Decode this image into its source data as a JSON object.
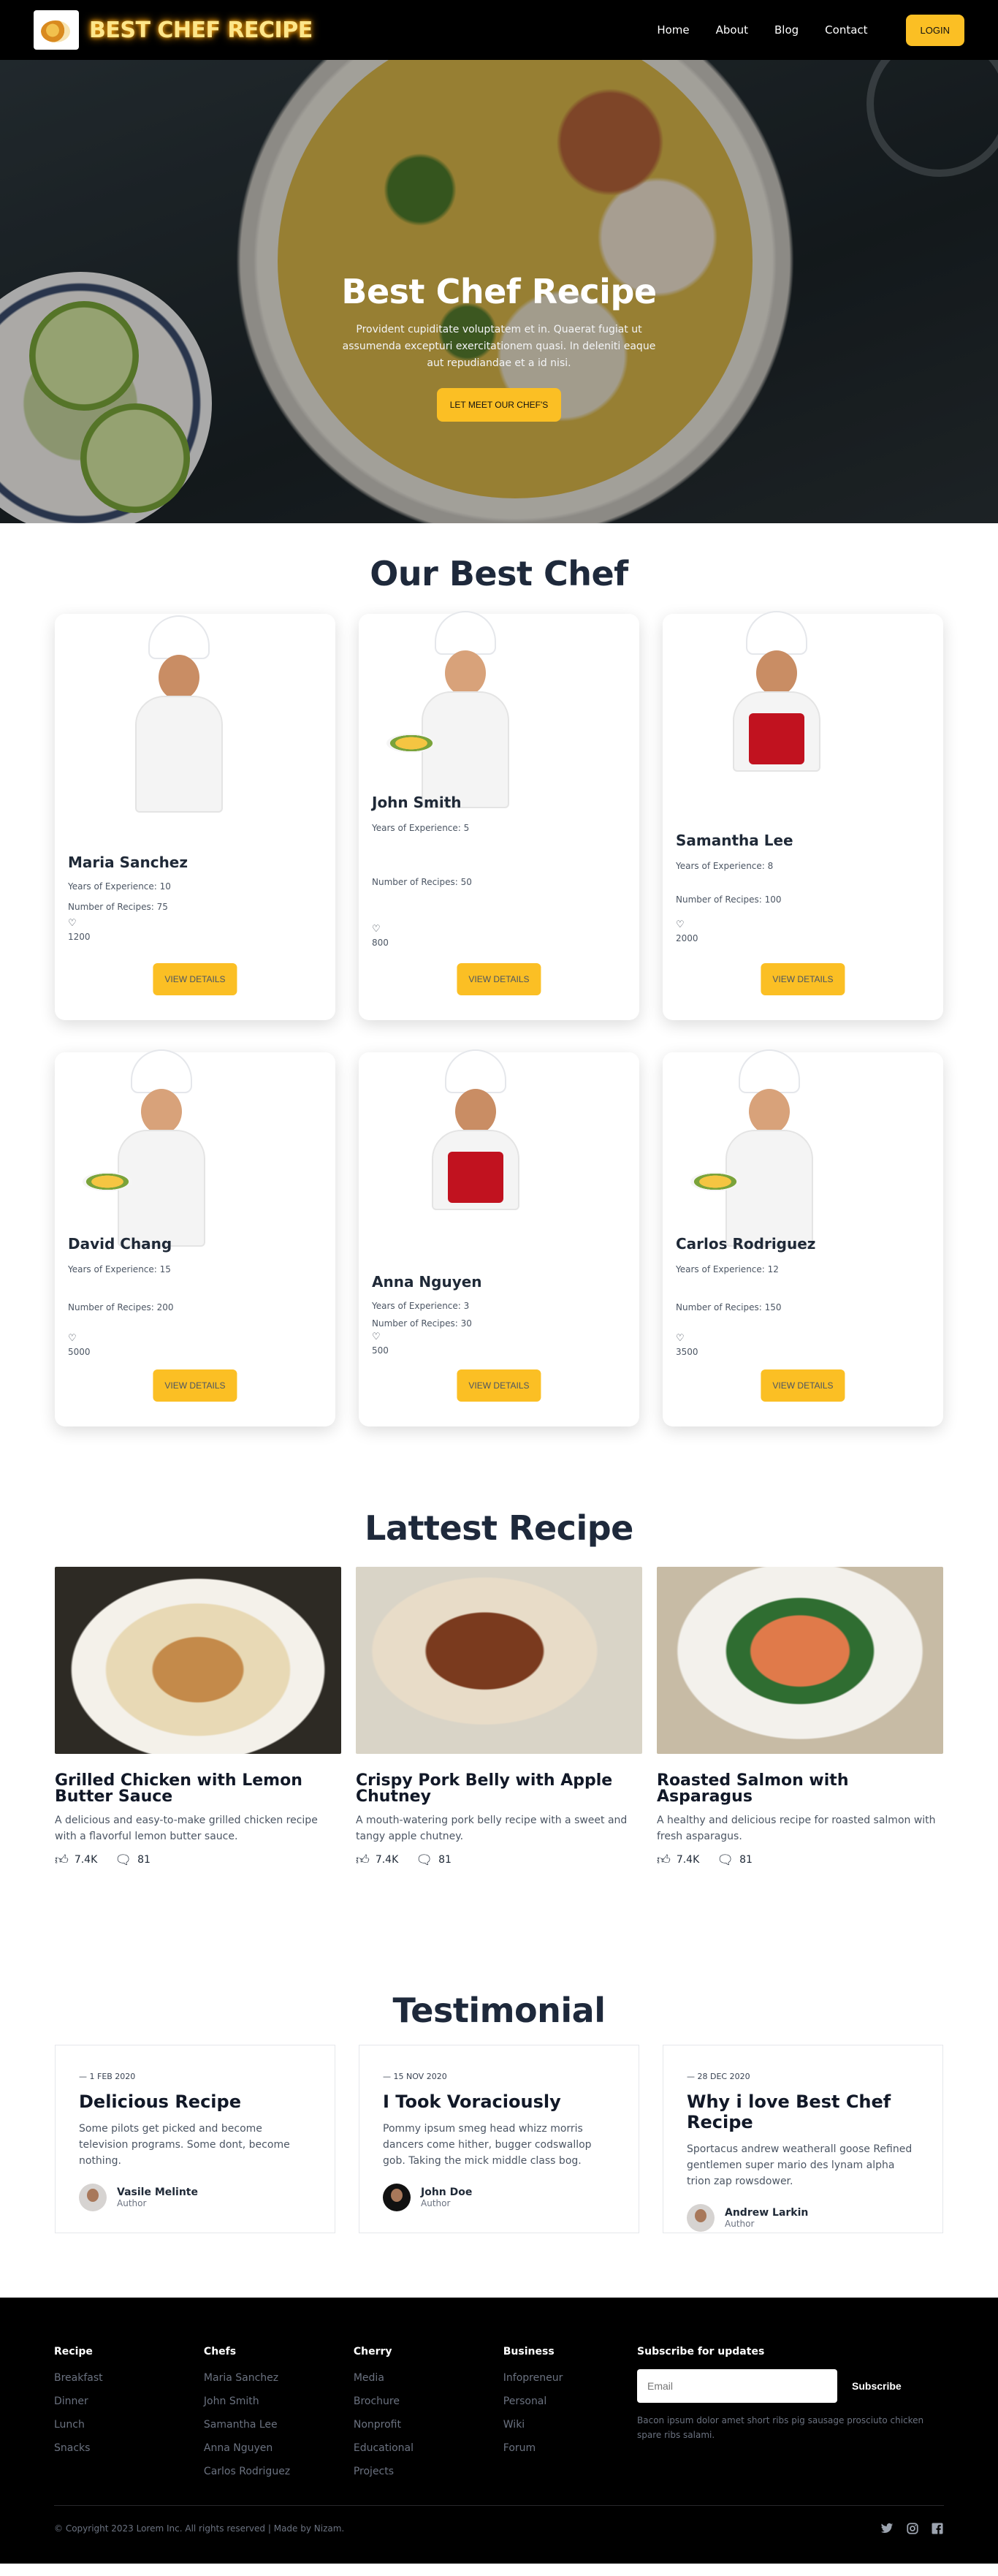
{
  "nav": {
    "logo_text": "BEST CHEF RECIPE",
    "links": [
      "Home",
      "About",
      "Blog",
      "Contact"
    ],
    "login_label": "LOGIN"
  },
  "hero": {
    "title": "Best Chef Recipe",
    "text": "Provident cupiditate voluptatem et in. Quaerat fugiat ut assumenda excepturi exercitationem quasi. In deleniti eaque aut repudiandae et a id nisi.",
    "button_label": "LET MEET OUR CHEF'S"
  },
  "chefs": {
    "title": "Our Best Chef",
    "experience_prefix": "Years of Experience: ",
    "recipes_prefix": "Number of Recipes: ",
    "heart_icon": "♡",
    "button_label": "VIEW DETAILS",
    "items": [
      {
        "name": "Maria Sanchez",
        "experience": "Years of Experience: 10",
        "recipes": "Number of Recipes: 75",
        "likes": "1200"
      },
      {
        "name": "John Smith",
        "experience": "Years of Experience: 5",
        "recipes": "Number of Recipes: 50",
        "likes": "800"
      },
      {
        "name": "Samantha Lee",
        "experience": "Years of Experience: 8",
        "recipes": "Number of Recipes: 100",
        "likes": "2000"
      },
      {
        "name": "David Chang",
        "experience": "Years of Experience: 15",
        "recipes": "Number of Recipes: 200",
        "likes": "5000"
      },
      {
        "name": "Anna Nguyen",
        "experience": "Years of Experience: 3",
        "recipes": "Number of Recipes: 30",
        "likes": "500"
      },
      {
        "name": "Carlos Rodriguez",
        "experience": "Years of Experience: 12",
        "recipes": "Number of Recipes: 150",
        "likes": "3500"
      }
    ]
  },
  "recipes": {
    "title": "Lattest Recipe",
    "items": [
      {
        "title": "Grilled Chicken with Lemon Butter Sauce",
        "desc": "A delicious and easy-to-make grilled chicken recipe with a flavorful lemon butter sauce.",
        "likes": "7.4K",
        "comments": "81"
      },
      {
        "title": "Crispy Pork Belly with Apple Chutney",
        "desc": "A mouth-watering pork belly recipe with a sweet and tangy apple chutney.",
        "likes": "7.4K",
        "comments": "81"
      },
      {
        "title": "Roasted Salmon with Asparagus",
        "desc": "A healthy and delicious recipe for roasted salmon with fresh asparagus.",
        "likes": "7.4K",
        "comments": "81"
      }
    ]
  },
  "testimonials": {
    "title": "Testimonial",
    "items": [
      {
        "date": "— 1 FEB 2020",
        "title": "Delicious Recipe",
        "text": "Some pilots get picked and become television programs. Some dont, become nothing.",
        "name": "Vasile Melinte",
        "role": "Author"
      },
      {
        "date": "— 15 NOV 2020",
        "title": "I Took Voraciously",
        "text": "Pommy ipsum smeg head whizz morris dancers come hither, bugger codswallop gob. Taking the mick middle class bog.",
        "name": "John Doe",
        "role": "Author"
      },
      {
        "date": "— 28 DEC 2020",
        "title": "Why i love Best Chef Recipe",
        "text": "Sportacus andrew weatherall goose Refined gentlemen super mario des lynam alpha trion zap rowsdower.",
        "name": "Andrew Larkin",
        "role": "Author"
      }
    ]
  },
  "footer": {
    "columns": [
      {
        "title": "Recipe",
        "links": [
          "Breakfast",
          "Dinner",
          "Lunch",
          "Snacks"
        ]
      },
      {
        "title": "Chefs",
        "links": [
          "Maria Sanchez",
          "John Smith",
          "Samantha Lee",
          "Anna Nguyen",
          "Carlos Rodriguez"
        ]
      },
      {
        "title": "Cherry",
        "links": [
          "Media",
          "Brochure",
          "Nonprofit",
          "Educational",
          "Projects"
        ]
      },
      {
        "title": "Business",
        "links": [
          "Infopreneur",
          "Personal",
          "Wiki",
          "Forum"
        ]
      }
    ],
    "subscribe_title": "Subscribe for updates",
    "email_placeholder": "Email",
    "subscribe_label": "Subscribe",
    "subscribe_note": "Bacon ipsum dolor amet short ribs pig sausage prosciuto chicken spare ribs salami.",
    "copyright": "© Copyright 2023 Lorem Inc. All rights reserved | Made by Nizam.",
    "social_icons": [
      "twitter-icon",
      "instagram-icon",
      "facebook-icon"
    ]
  },
  "colors": {
    "accent": "#fbbf24",
    "dark": "#000000",
    "heading": "#1e293b"
  }
}
